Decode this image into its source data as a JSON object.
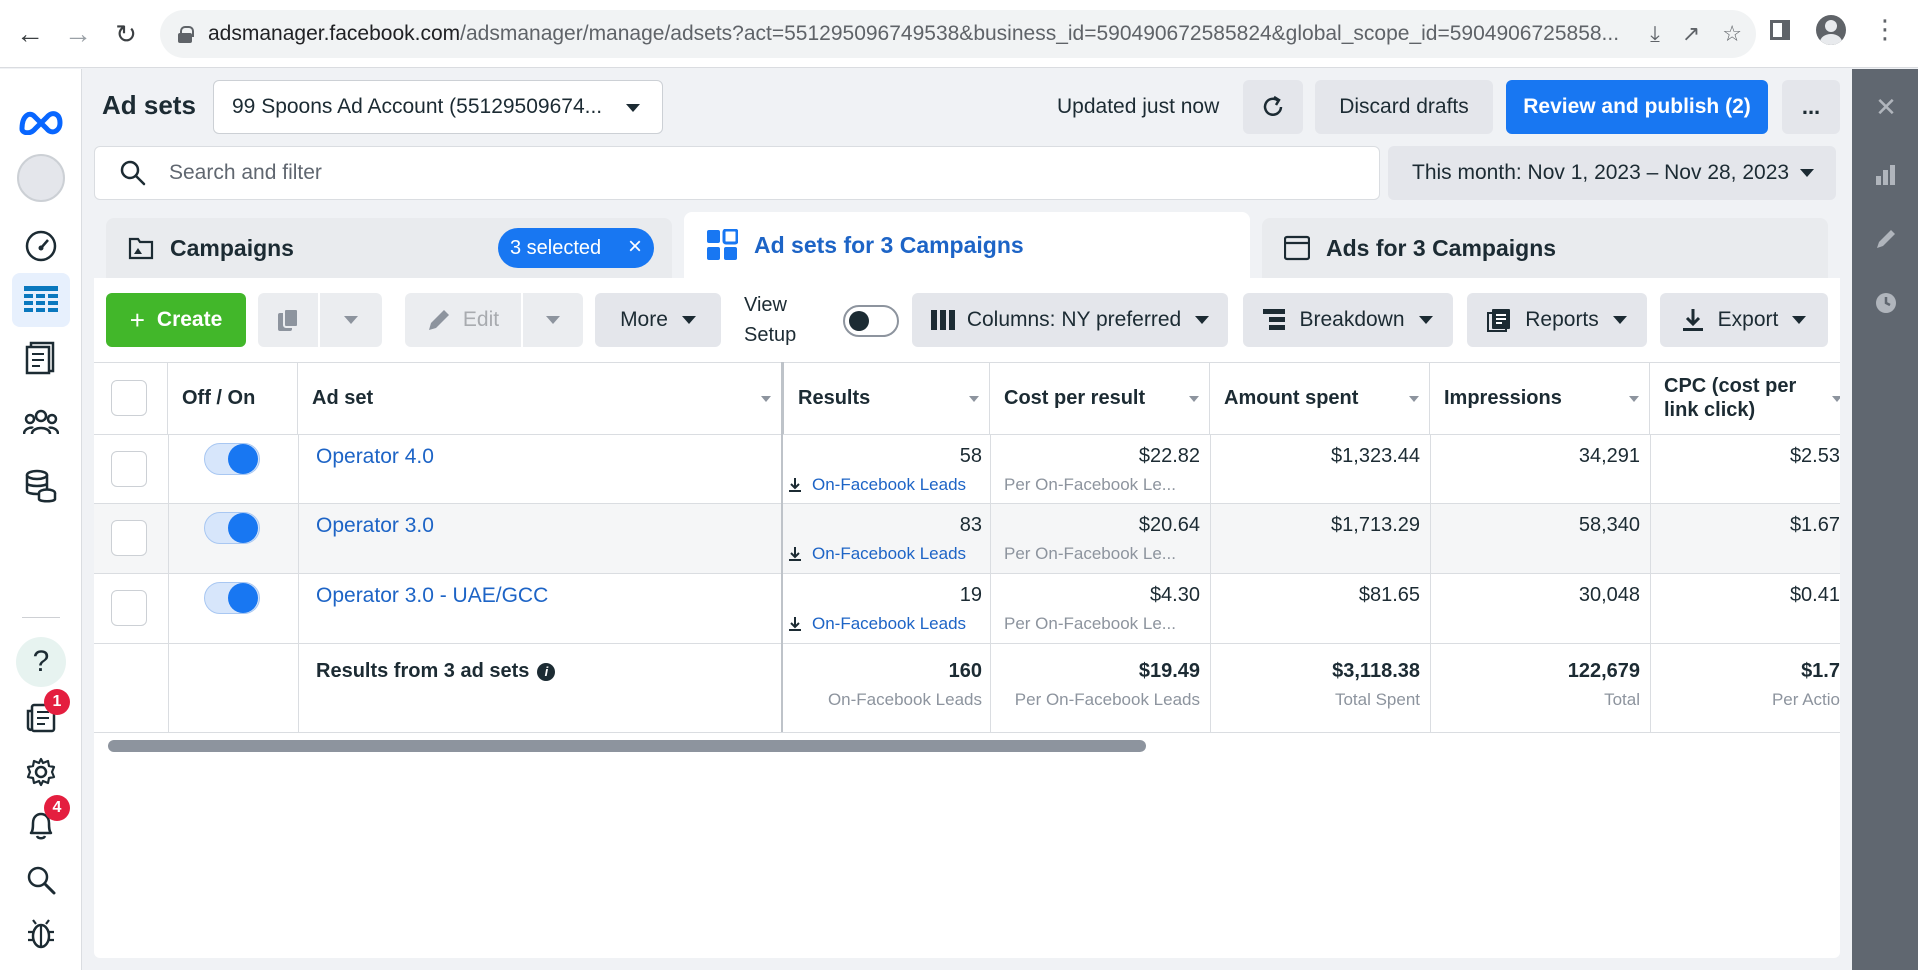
{
  "browser": {
    "url_host": "adsmanager.facebook.com",
    "url_path": "/adsmanager/manage/adsets?act=551295096749538&business_id=590490672585824&global_scope_id=5904906725858..."
  },
  "left_nav": {
    "notifications_badge": "1",
    "alerts_badge": "4"
  },
  "header": {
    "title": "Ad sets",
    "account": "99 Spoons Ad Account (55129509674...",
    "updated": "Updated just now",
    "discard": "Discard drafts",
    "publish": "Review and publish (2)",
    "more": "..."
  },
  "search": {
    "placeholder": "Search and filter",
    "date_range": "This month: Nov 1, 2023 – Nov 28, 2023"
  },
  "tabs": {
    "campaigns": "Campaigns",
    "selected_chip": "3 selected",
    "adsets": "Ad sets for 3 Campaigns",
    "ads": "Ads for 3 Campaigns"
  },
  "toolbar": {
    "create": "Create",
    "edit": "Edit",
    "more": "More",
    "view_setup_1": "View",
    "view_setup_2": "Setup",
    "columns": "Columns: NY preferred",
    "breakdown": "Breakdown",
    "reports": "Reports",
    "export": "Export"
  },
  "table": {
    "headers": {
      "off_on": "Off / On",
      "ad_set": "Ad set",
      "results": "Results",
      "cost_per_result": "Cost per result",
      "amount_spent": "Amount spent",
      "impressions": "Impressions",
      "cpc_1": "CPC (cost per",
      "cpc_2": "link click)"
    },
    "rows": [
      {
        "name": "Operator 4.0",
        "results": "58",
        "results_type": "On-Facebook Leads",
        "cost": "$22.82",
        "cost_sub": "Per On-Facebook Le...",
        "spent": "$1,323.44",
        "impressions": "34,291",
        "cpc": "$2.53"
      },
      {
        "name": "Operator 3.0",
        "results": "83",
        "results_type": "On-Facebook Leads",
        "cost": "$20.64",
        "cost_sub": "Per On-Facebook Le...",
        "spent": "$1,713.29",
        "impressions": "58,340",
        "cpc": "$1.67"
      },
      {
        "name": "Operator 3.0 - UAE/GCC",
        "results": "19",
        "results_type": "On-Facebook Leads",
        "cost": "$4.30",
        "cost_sub": "Per On-Facebook Le...",
        "spent": "$81.65",
        "impressions": "30,048",
        "cpc": "$0.41"
      }
    ],
    "totals": {
      "label": "Results from 3 ad sets",
      "results": "160",
      "results_sub": "On-Facebook Leads",
      "cost": "$19.49",
      "cost_sub": "Per On-Facebook Leads",
      "spent": "$3,118.38",
      "spent_sub": "Total Spent",
      "impressions": "122,679",
      "impressions_sub": "Total",
      "cpc": "$1.7",
      "cpc_sub": "Per Actio"
    }
  },
  "colors": {
    "primary_blue": "#1877f2",
    "link_blue": "#1d64c6",
    "create_green": "#42b72a"
  }
}
